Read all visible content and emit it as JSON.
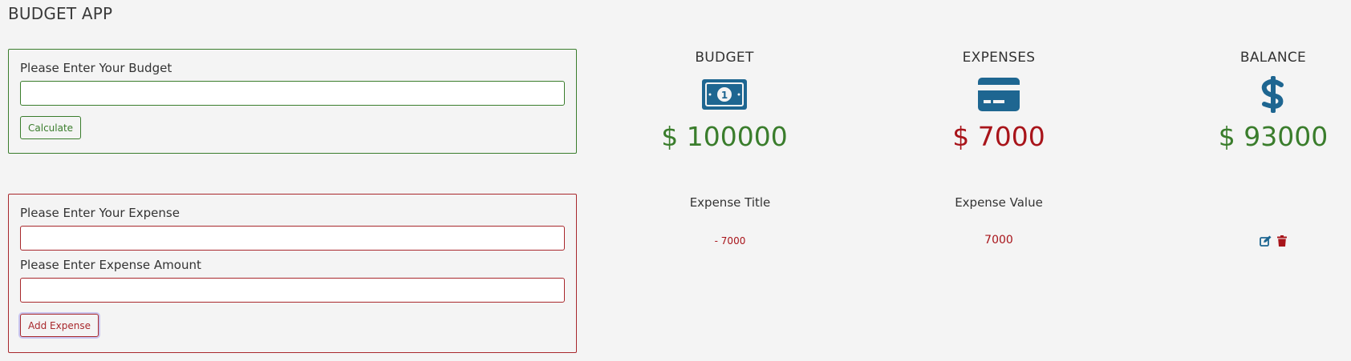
{
  "app": {
    "title": "BUDGET APP"
  },
  "budget_form": {
    "label": "Please Enter Your Budget",
    "input_value": "",
    "button_label": "Calculate"
  },
  "expense_form": {
    "title_label": "Please Enter Your Expense",
    "title_value": "",
    "amount_label": "Please Enter Expense Amount",
    "amount_value": "",
    "button_label": "Add Expense"
  },
  "summary": {
    "budget": {
      "title": "BUDGET",
      "icon": "money-bill-icon",
      "amount": "$ 100000"
    },
    "expenses": {
      "title": "EXPENSES",
      "icon": "credit-card-icon",
      "amount": "$ 7000"
    },
    "balance": {
      "title": "BALANCE",
      "icon": "dollar-sign-icon",
      "amount": "$ 93000"
    }
  },
  "expense_list": {
    "headers": {
      "title": "Expense Title",
      "value": "Expense Value"
    },
    "rows": [
      {
        "title": "- 7000",
        "value": "7000",
        "actions": [
          "edit-icon",
          "delete-icon"
        ]
      }
    ]
  },
  "colors": {
    "accent_green": "#3a7d2c",
    "accent_red": "#a8141a",
    "icon_blue": "#1e6691",
    "background": "#f4f4f4"
  }
}
